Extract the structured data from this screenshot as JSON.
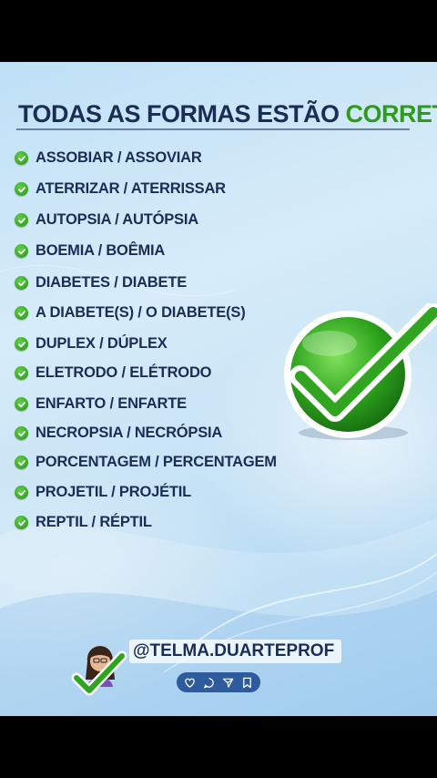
{
  "title": {
    "prefix": "TODAS AS FORMAS ESTÃO",
    "highlight": "CORRETAS:"
  },
  "items": [
    "ASSOBIAR / ASSOVIAR",
    "ATERRIZAR / ATERRISSAR",
    "AUTOPSIA / AUTÓPSIA",
    "BOEMIA / BOÊMIA",
    "DIABETES / DIABETE",
    "A DIABETE(S) / O DIABETE(S)",
    "DUPLEX / DÚPLEX",
    "ELETRODO / ELÉTRODO",
    "ENFARTO / ENFARTE",
    "NECROPSIA / NECRÓPSIA",
    "PORCENTAGEM / PERCENTAGEM",
    "PROJETIL / PROJÉTIL",
    "REPTIL / RÉPTIL"
  ],
  "footer": {
    "handle_prefix": "@TELMA.",
    "handle_suffix": "DUARTEPROF",
    "icons": [
      "heart-icon",
      "comment-icon",
      "send-icon",
      "bookmark-icon"
    ]
  },
  "colors": {
    "navy": "#1b2d55",
    "green": "#2f9a1e",
    "icon_bar": "#2e5b9e"
  }
}
